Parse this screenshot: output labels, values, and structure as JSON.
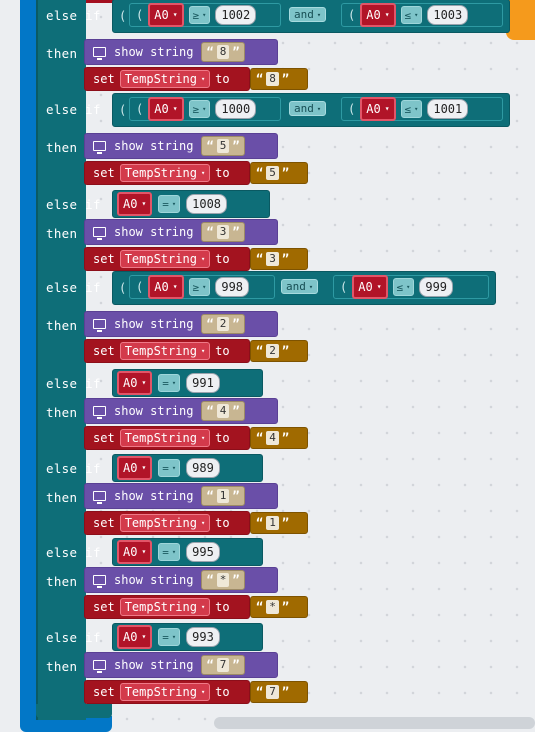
{
  "labels": {
    "else_if": "else if",
    "then": "then",
    "and": "and",
    "show_string": "show string",
    "set": "set",
    "to": "to",
    "open_paren": "(",
    "quote": "“",
    "quote_close": "”"
  },
  "variables": {
    "a0": "A0",
    "temp": "TempString"
  },
  "dropdown_arrow": "▾",
  "branches": [
    {
      "cond_type": "range",
      "op1": "≥",
      "val1": "1002",
      "op2": "≤",
      "val2": "1003",
      "show": "8",
      "set": "8"
    },
    {
      "cond_type": "range",
      "op1": "≥",
      "val1": "1000",
      "op2": "≤",
      "val2": "1001",
      "show": "5",
      "set": "5"
    },
    {
      "cond_type": "eq",
      "op1": "=",
      "val1": "1008",
      "show": "3",
      "set": "3"
    },
    {
      "cond_type": "range",
      "op1": "≥",
      "val1": "998",
      "op2": "≤",
      "val2": "999",
      "show": "2",
      "set": "2"
    },
    {
      "cond_type": "eq",
      "op1": "=",
      "val1": "991",
      "show": "4",
      "set": "4"
    },
    {
      "cond_type": "eq",
      "op1": "=",
      "val1": "989",
      "show": "1",
      "set": "1"
    },
    {
      "cond_type": "eq",
      "op1": "=",
      "val1": "995",
      "show": "*",
      "set": "*"
    },
    {
      "cond_type": "eq",
      "op1": "=",
      "val1": "993",
      "show": "7",
      "set": "7"
    }
  ],
  "colors": {
    "control": "#0e6e78",
    "show": "#6a4fa8",
    "set": "#a3131f",
    "var": "#b11428",
    "string": "#a06a00",
    "basic": "#0277c7"
  }
}
